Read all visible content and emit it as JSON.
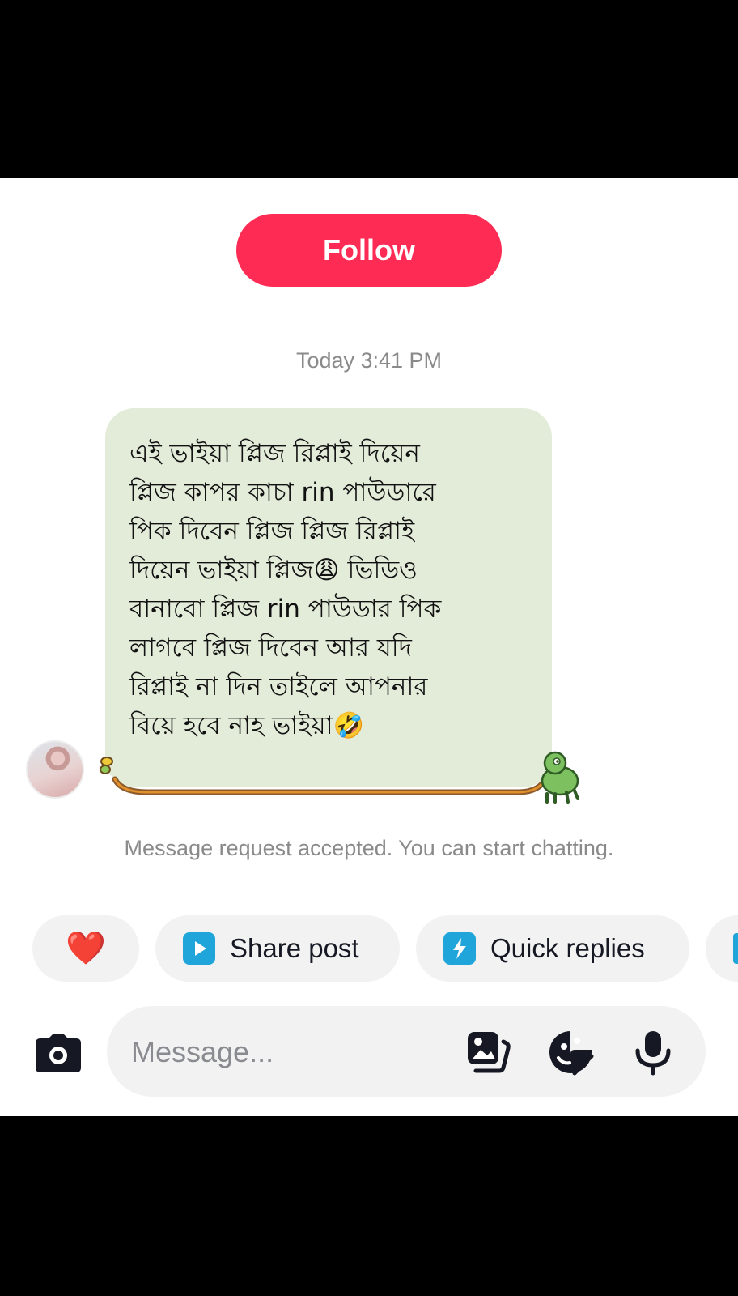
{
  "follow_label": "Follow",
  "timestamp": "Today 3:41 PM",
  "message": {
    "text": "এই ভাইয়া প্লিজ রিপ্লাই দিয়েন\nপ্লিজ কাপর কাচা rin পাউডারে\nপিক দিবেন প্লিজ প্লিজ রিপ্লাই\nদিয়েন ভাইয়া প্লিজ😩  ভিডিও\nবানাবো প্লিজ rin পাউডার পিক\nলাগবে প্লিজ দিবেন আর যদি\nরিপ্লাই না দিন তাইলে আপনার\nবিয়ে হবে নাহ ভাইয়া🤣"
  },
  "status_text": "Message request accepted. You can start chatting.",
  "chips": {
    "heart": "❤️",
    "share_label": "Share post",
    "quick_label": "Quick replies"
  },
  "input": {
    "placeholder": "Message..."
  },
  "colors": {
    "accent": "#fe2c55",
    "bubble": "#e3ebd9",
    "chip_icon": "#1fa5d9"
  }
}
